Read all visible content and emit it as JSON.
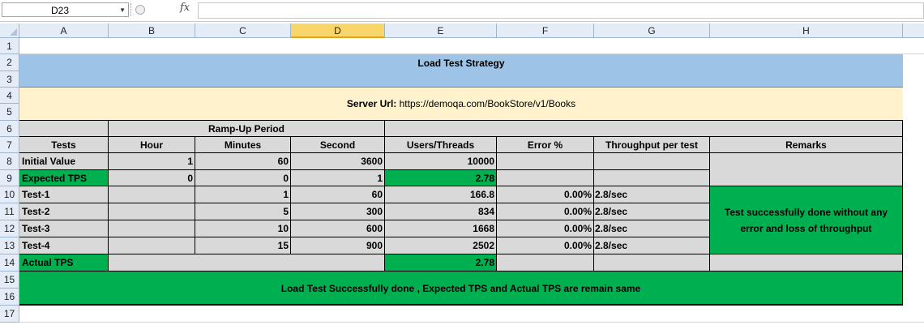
{
  "formula_bar": {
    "name_box": "D23",
    "fx_label": "fx",
    "formula": ""
  },
  "columns": [
    "A",
    "B",
    "C",
    "D",
    "E",
    "F",
    "G",
    "H"
  ],
  "rows": [
    "1",
    "2",
    "3",
    "4",
    "5",
    "6",
    "7",
    "8",
    "9",
    "10",
    "11",
    "12",
    "13",
    "14",
    "15",
    "16",
    "17"
  ],
  "sheet": {
    "title": "Load Test Strategy",
    "server_url_label": "Server Url:",
    "server_url_value": " https://demoqa.com/BookStore/v1/Books",
    "ramp_up_header": "Ramp-Up Period",
    "headers": {
      "tests": "Tests",
      "hour": "Hour",
      "minutes": "Minutes",
      "second": "Second",
      "users": "Users/Threads",
      "error": "Error %",
      "throughput": "Throughput per test",
      "remarks": "Remarks"
    },
    "initial_value": {
      "label": "Initial Value",
      "hour": "1",
      "minutes": "60",
      "second": "3600",
      "users": "10000"
    },
    "expected_tps": {
      "label": "Expected TPS",
      "hour": "0",
      "minutes": "0",
      "second": "1",
      "users": "2.78"
    },
    "tests": [
      {
        "label": "Test-1",
        "minutes": "1",
        "second": "60",
        "users": "166.8",
        "error": "0.00%",
        "throughput": "2.8/sec"
      },
      {
        "label": "Test-2",
        "minutes": "5",
        "second": "300",
        "users": "834",
        "error": "0.00%",
        "throughput": "2.8/sec"
      },
      {
        "label": "Test-3",
        "minutes": "10",
        "second": "600",
        "users": "1668",
        "error": "0.00%",
        "throughput": "2.8/sec"
      },
      {
        "label": "Test-4",
        "minutes": "15",
        "second": "900",
        "users": "2502",
        "error": "0.00%",
        "throughput": "2.8/sec"
      }
    ],
    "remarks_line1": "Test successfully done  without any",
    "remarks_line2": "error and loss  of  throughput",
    "actual_tps": {
      "label": "Actual TPS",
      "users": "2.78"
    },
    "conclusion": "Load Test Successfully done , Expected TPS and Actual TPS are remain  same"
  },
  "colors": {
    "title_band": "#9dc3e6",
    "url_band": "#fff2cc",
    "table_gray": "#d9d9d9",
    "green": "#00b050",
    "selected_column": "#f8d66a"
  }
}
